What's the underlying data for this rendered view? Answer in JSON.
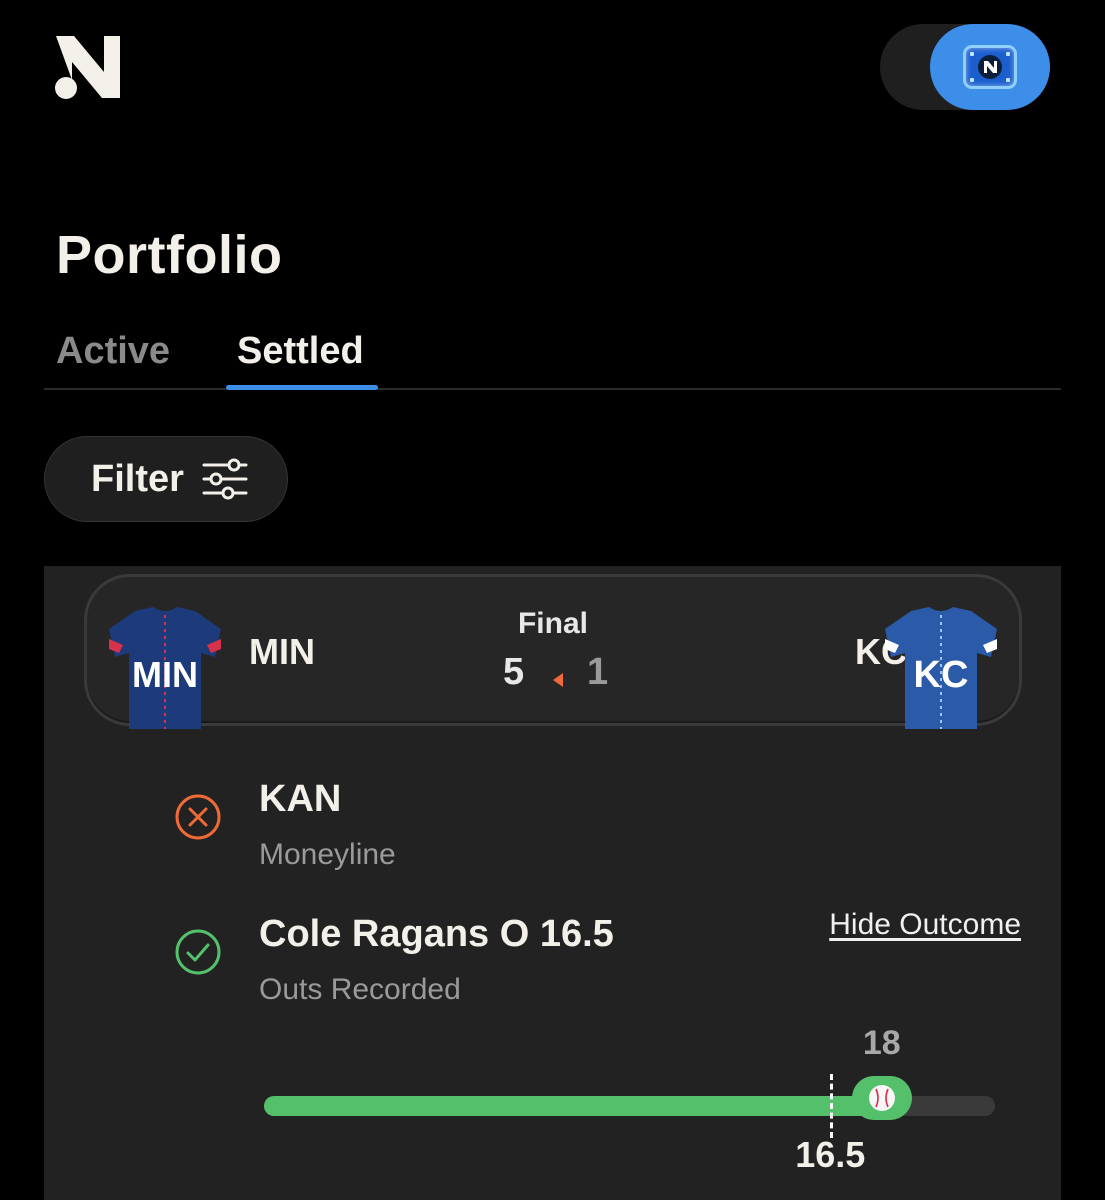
{
  "header": {
    "logo": "N-logo",
    "toggle_state": "on",
    "toggle_icon": "app-icon"
  },
  "page": {
    "title": "Portfolio"
  },
  "tabs": [
    {
      "label": "Active",
      "selected": false
    },
    {
      "label": "Settled",
      "selected": true
    }
  ],
  "filter": {
    "label": "Filter",
    "icon": "sliders-icon"
  },
  "game": {
    "status": "Final",
    "home": {
      "abbr": "MIN",
      "score": "5",
      "jersey_text": "MIN"
    },
    "away": {
      "abbr": "KC",
      "score": "1",
      "jersey_text": "KC"
    },
    "winner_indicator": "home"
  },
  "legs": [
    {
      "title": "KAN",
      "subtitle": "Moneyline",
      "result": "lost",
      "icon": "x-circle-icon",
      "color": "#f06a35"
    },
    {
      "title": "Cole Ragans O 16.5",
      "subtitle": "Outs Recorded",
      "result": "won",
      "icon": "check-circle-icon",
      "color": "#55c06b"
    }
  ],
  "outcome": {
    "toggle_label": "Hide Outcome",
    "line_label": "16.5",
    "result_label": "18",
    "line": 16.5,
    "result": 18,
    "scale_max": 21.3
  },
  "colors": {
    "accent": "#3d8ee9",
    "win": "#55c06b",
    "loss": "#f06a35"
  }
}
